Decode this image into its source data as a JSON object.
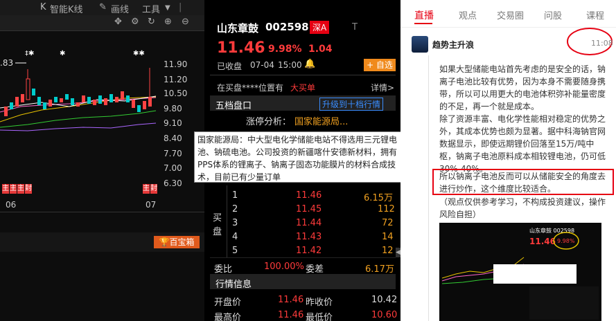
{
  "chart_toolbar": {
    "smart_k_label": "智能K线",
    "draw_label": "画线",
    "tools_label": "工具"
  },
  "chart": {
    "price_ticks": [
      "11.90",
      "11.20",
      "10.50",
      "9.80",
      "9.10",
      "8.40",
      "7.70",
      "7.00",
      "6.30"
    ],
    "date_labels": [
      "06",
      "07"
    ],
    "prev_close_marker": ".83",
    "limit_up_label": "封",
    "limit_up_short": "主",
    "baibao_label": "百宝箱"
  },
  "quote": {
    "name": "山东章鼓",
    "code": "002598",
    "market": "深A",
    "flag": "T",
    "price": "11.46",
    "change_pct": "9.98%",
    "change": "1.04",
    "status": "已收盘",
    "date": "07-04",
    "time": "15:00",
    "watch_label": "+ 自选",
    "buy_position_text": "在买盘****位置有",
    "buy_position_badge": "大买单",
    "detail_link": "详情>",
    "five_level_title": "五档盘口",
    "upgrade_label": "升级到十档行情",
    "limit_reason_label": "涨停分析：",
    "limit_reason_value": "国家能源局...",
    "bid_side_label": [
      "买",
      "盘"
    ],
    "bids": [
      {
        "level": "1",
        "price": "11.46",
        "vol": "6.15万"
      },
      {
        "level": "2",
        "price": "11.45",
        "vol": "112"
      },
      {
        "level": "3",
        "price": "11.44",
        "vol": "72"
      },
      {
        "level": "4",
        "price": "11.43",
        "vol": "14"
      },
      {
        "level": "5",
        "price": "11.42",
        "vol": "12"
      }
    ],
    "ratio_label": "委比",
    "ratio_value": "100.00%",
    "diff_label": "委差",
    "diff_value": "6.17万",
    "info_title": "行情信息",
    "open_label": "开盘价",
    "open_value": "11.46",
    "prev_close_label": "昨收价",
    "prev_close_value": "10.42",
    "high_label": "最高价",
    "high_value": "11.46",
    "low_label": "最低价",
    "low_value": "10.60"
  },
  "tooltip": {
    "text": "国家能源局：中大型电化学储能电站不得选用三元锂电池、钠硫电池。公司投资的新疆喀什安德新材料，拥有PPS体系的锂离子、钠离子固态功能膜片的材料合成技术，目前已有少量订单"
  },
  "social": {
    "tabs": [
      "直播",
      "观点",
      "交易圈",
      "问股",
      "课程"
    ],
    "active_tab": "直播",
    "author": "趋势主升浪",
    "time": "11:08",
    "paragraph1": "如果大型储能电站首先考虑的是安全的话，钠离子电池比较有优势，因为本身不需要随身携带，所以可以用更大的电池体积弥补能量密度的不足，再一个就是成本。",
    "paragraph2": "除了资源丰富、电化学性能相对稳定的优势之外，其成本优势也颇为显著。据中科海钠官网数据显示，即使远期锂价回落至15万/吨中枢，钠离子电池原料成本相较锂电池，仍可低30%-40%。",
    "highlight": "所以钠离子电池反而可以从储能安全的角度去进行炒作，这个维度比较适合。",
    "disclaimer": "（观点仅供参考学习，不构成投资建议，操作风险自担）",
    "thumb_name": "山东章鼓 002598",
    "thumb_price": "11.46",
    "thumb_pct": "9.98%"
  },
  "colors": {
    "up": "#ff3b3b",
    "orange": "#ff9900",
    "accent_red": "#e60012",
    "chart_bg": "#0d0d0d",
    "quote_bg": "#000000"
  }
}
